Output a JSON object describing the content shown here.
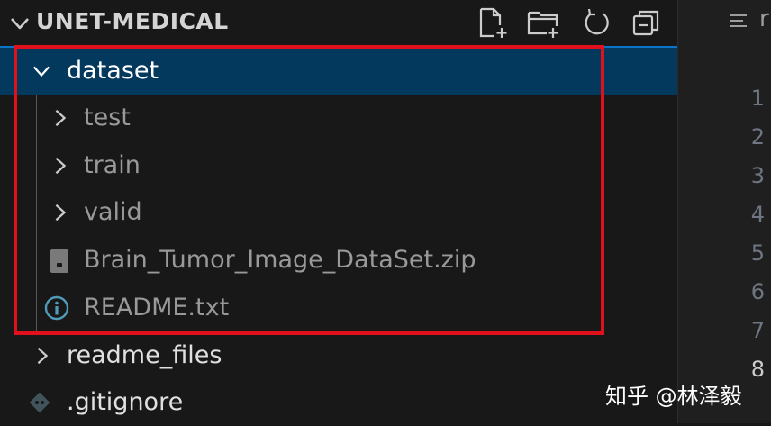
{
  "explorer": {
    "title": "UNET-MEDICAL",
    "actions": [
      {
        "name": "new-file-icon"
      },
      {
        "name": "new-folder-icon"
      },
      {
        "name": "refresh-icon"
      },
      {
        "name": "collapse-all-icon"
      }
    ],
    "tree": [
      {
        "label": "dataset",
        "type": "folder",
        "expanded": true,
        "selected": true,
        "depth": 0
      },
      {
        "label": "test",
        "type": "folder",
        "expanded": false,
        "depth": 1
      },
      {
        "label": "train",
        "type": "folder",
        "expanded": false,
        "depth": 1
      },
      {
        "label": "valid",
        "type": "folder",
        "expanded": false,
        "depth": 1
      },
      {
        "label": "Brain_Tumor_Image_DataSet.zip",
        "type": "file",
        "icon": "zip-file-icon",
        "depth": 1
      },
      {
        "label": "README.txt",
        "type": "file",
        "icon": "info-icon",
        "depth": 1
      },
      {
        "label": "readme_files",
        "type": "folder",
        "expanded": false,
        "depth": 0
      },
      {
        "label": ".gitignore",
        "type": "file",
        "icon": "git-icon",
        "depth": 0
      }
    ]
  },
  "editor": {
    "tab_partial": "r",
    "line_numbers": [
      "1",
      "2",
      "3",
      "4",
      "5",
      "6",
      "7",
      "8"
    ],
    "current_line": "8"
  },
  "watermark": "知乎 @林泽毅",
  "colors": {
    "background": "#181818",
    "selection": "#04395e",
    "focus_border": "#0b74c9",
    "highlight_box": "#e0101c"
  }
}
